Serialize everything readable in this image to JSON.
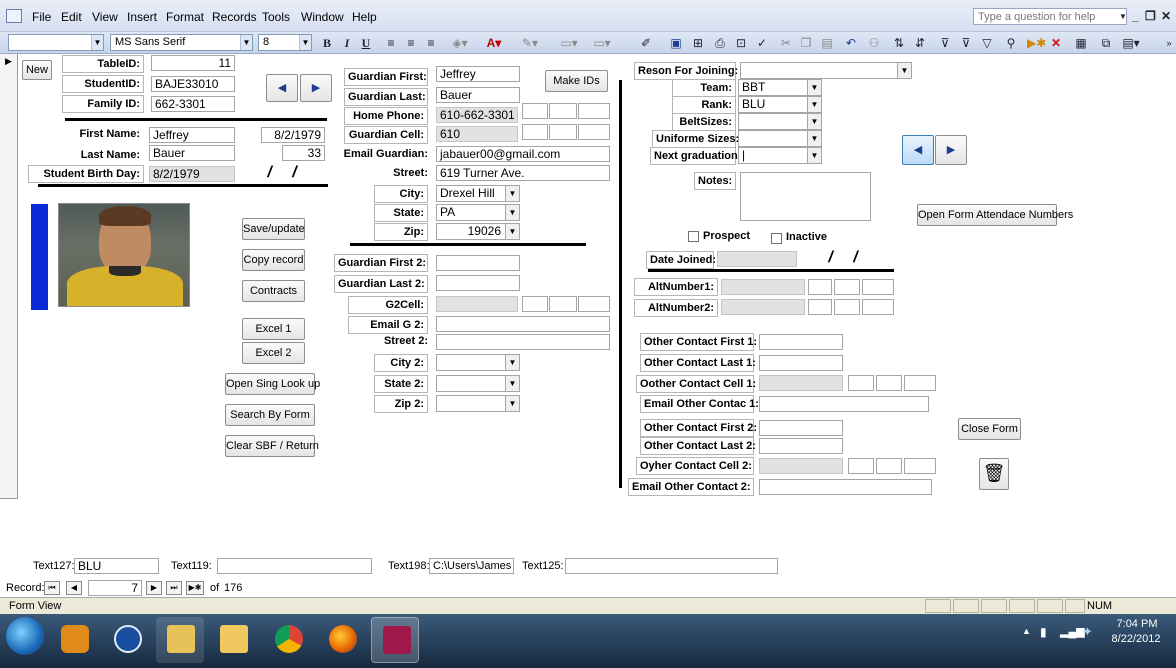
{
  "menubar": {
    "items": [
      "File",
      "Edit",
      "View",
      "Insert",
      "Format",
      "Records",
      "Tools",
      "Window",
      "Help"
    ],
    "help_placeholder": "Type a question for help"
  },
  "toolbar": {
    "font_name": "MS Sans Serif",
    "font_size": "8",
    "bold": "B",
    "italic": "I",
    "underline": "U"
  },
  "form": {
    "new_label": "New",
    "table_id_label": "TableID:",
    "table_id": "11",
    "student_id_label": "StudentID:",
    "student_id": "BAJE33010",
    "family_id_label": "Family ID:",
    "family_id": "662-3301",
    "first_name_label": "First Name:",
    "first_name": "Jeffrey",
    "last_name_label": "Last Name:",
    "last_name": "Bauer",
    "birth_label": "Student Birth Day:",
    "birth_day": "8/2/1979",
    "birth_display": "8/2/1979",
    "age": "33",
    "date_mask": "/ /",
    "prev_glyph": "◀",
    "next_glyph": "▶",
    "make_ids_label": "Make IDs",
    "buttons": {
      "save": "Save/update",
      "copy": "Copy record",
      "contracts": "Contracts",
      "excel1": "Excel 1",
      "excel2": "Excel 2",
      "sing_lookup": "Open Sing Look up",
      "search_form": "Search By Form",
      "clear_sbf": "Clear SBF / Return",
      "attendance": "Open Form Attendace Numbers",
      "close": "Close Form"
    },
    "guardian": {
      "first_label": "Guardian First:",
      "first": "Jeffrey",
      "last_label": "Guardian Last:",
      "last": "Bauer",
      "home_phone_label": "Home Phone:",
      "home_phone": "610-662-3301",
      "cell_label": "Guardian Cell:",
      "cell": "610",
      "email_label": "Email Guardian:",
      "email": "jabauer00@gmail.com",
      "street_label": "Street:",
      "street": "619 Turner Ave.",
      "city_label": "City:",
      "city": "Drexel Hill",
      "state_label": "State:",
      "state": "PA",
      "zip_label": "Zip:",
      "zip": "19026"
    },
    "guardian2": {
      "first_label": "Guardian First 2:",
      "last_label": "Guardian Last 2:",
      "cell_label": "G2Cell:",
      "email_label": "Email G 2:",
      "street_label": "Street 2:",
      "city_label": "City 2:",
      "state_label": "State 2:",
      "zip_label": "Zip 2:"
    },
    "right": {
      "reason_label": "Reson For Joining:",
      "team_label": "Team:",
      "team": "BBT",
      "rank_label": "Rank:",
      "rank": "BLU",
      "belt_label": "BeltSizes:",
      "uniform_label": "Uniforme Sizes:",
      "graduation_label": "Next graduation:",
      "graduation": "|",
      "notes_label": "Notes:",
      "prospect_label": "Prospect",
      "inactive_label": "Inactive",
      "date_joined_label": "Date Joined:",
      "alt1_label": "AltNumber1:",
      "alt2_label": "AltNumber2:"
    },
    "other_contacts": {
      "first1_label": "Other Contact First 1:",
      "last1_label": "Other Contact Last 1:",
      "cell1_label": "Oother Contact Cell 1:",
      "email1_label": "Email Other Contac 1:",
      "first2_label": "Other Contact First 2:",
      "last2_label": "Other Contact Last 2:",
      "cell2_label": "Oyher Contact Cell 2:",
      "email2_label": "Email Other Contact 2:"
    },
    "bottom": {
      "text127_label": "Text127:",
      "text127": "BLU",
      "text119_label": "Text119:",
      "text198_label": "Text198:",
      "text198": "C:\\Users\\James Bre",
      "text125_label": "Text125:"
    }
  },
  "record_nav": {
    "label": "Record:",
    "current": "7",
    "of_label": "of",
    "total": "176"
  },
  "statusbar": {
    "view": "Form View",
    "num": "NUM"
  },
  "taskbar": {
    "time": "7:04 PM",
    "date": "8/22/2012"
  },
  "colors": {
    "blue_bar": "#0a2ad8",
    "nav_active": "#4a90d9"
  }
}
